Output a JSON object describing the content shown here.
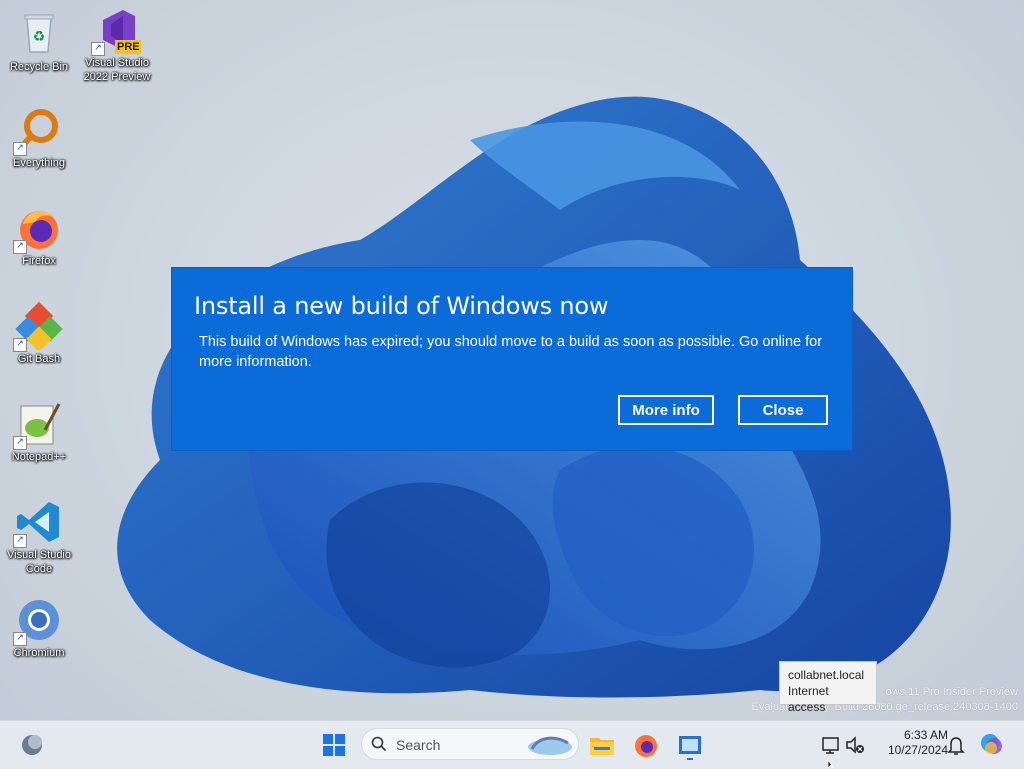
{
  "desktop": {
    "icons": [
      {
        "label": "Recycle Bin"
      },
      {
        "label": "Visual Studio 2022 Preview",
        "badge": "PRE"
      },
      {
        "label": "Everything"
      },
      {
        "label": "Firefox"
      },
      {
        "label": "Git Bash"
      },
      {
        "label": "Notepad++"
      },
      {
        "label": "Visual Studio Code"
      },
      {
        "label": "Chromium"
      }
    ]
  },
  "dialog": {
    "title": "Install a new build of Windows now",
    "message": "This build of Windows has expired; you should move to a build as soon as possible. Go online for more information.",
    "more_info_label": "More info",
    "close_label": "Close",
    "background_color": "#0b6cd9"
  },
  "watermark": {
    "line1": "ows 11 Pro Insider Preview",
    "line2": "Evaluation copy. Build 26080.ge_release.240308-1400"
  },
  "tooltip": {
    "line1": "collabnet.local",
    "line2": "Internet access"
  },
  "taskbar": {
    "search_placeholder": "Search",
    "clock_time": "6:33 AM",
    "clock_date": "10/27/2024",
    "pinned_icons": [
      "windows-start-icon",
      "file-explorer-icon",
      "firefox-icon",
      "app-icon"
    ]
  }
}
